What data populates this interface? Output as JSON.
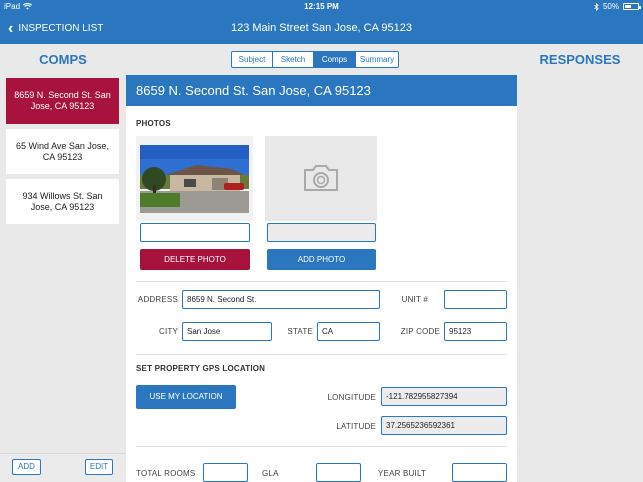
{
  "status_bar": {
    "device": "iPad",
    "time": "12:15 PM",
    "battery": "50%",
    "battery_fraction": 0.5
  },
  "nav": {
    "back_label": "INSPECTION LIST",
    "title": "123 Main Street San Jose, CA 95123"
  },
  "comps_header": "COMPS",
  "responses_header": "RESPONSES",
  "tabs": [
    {
      "label": "Subject",
      "active": false
    },
    {
      "label": "Sketch",
      "active": false
    },
    {
      "label": "Comps",
      "active": true
    },
    {
      "label": "Summary",
      "active": false
    }
  ],
  "comps": [
    {
      "label": "8659 N. Second St. San Jose, CA 95123",
      "selected": true
    },
    {
      "label": "65 Wind Ave San Jose, CA 95123",
      "selected": false
    },
    {
      "label": "934 Willows St. San Jose, CA 95123",
      "selected": false
    }
  ],
  "left_actions": {
    "add_label": "ADD",
    "edit_label": "EDIT"
  },
  "main": {
    "title": "8659 N. Second St. San Jose, CA 95123",
    "photos_label": "PHOTOS",
    "delete_photo_label": "DELETE PHOTO",
    "add_photo_label": "ADD PHOTO",
    "address_label": "ADDRESS",
    "address_value": "8659 N. Second St.",
    "unit_label": "UNIT #",
    "unit_value": "",
    "city_label": "CITY",
    "city_value": "San Jose",
    "state_label": "STATE",
    "state_value": "CA",
    "zip_label": "ZIP CODE",
    "zip_value": "95123",
    "gps_label": "SET PROPERTY GPS LOCATION",
    "use_location_label": "USE MY LOCATION",
    "longitude_label": "LONGITUDE",
    "longitude_value": "-121.782955827394",
    "latitude_label": "LATITUDE",
    "latitude_value": "37.2565236592361",
    "total_rooms_label": "TOTAL ROOMS",
    "total_rooms_value": "",
    "gla_label": "GLA",
    "gla_value": "",
    "year_built_label": "YEAR BUILT",
    "year_built_value": ""
  },
  "colors": {
    "accent": "#2a77bf",
    "brand_red": "#a8133e",
    "background": "#e9e9e9"
  },
  "icons": {
    "back": "chevron-left-icon",
    "camera": "camera-icon",
    "wifi": "wifi-icon",
    "bluetooth": "bluetooth-icon",
    "battery": "battery-icon"
  }
}
